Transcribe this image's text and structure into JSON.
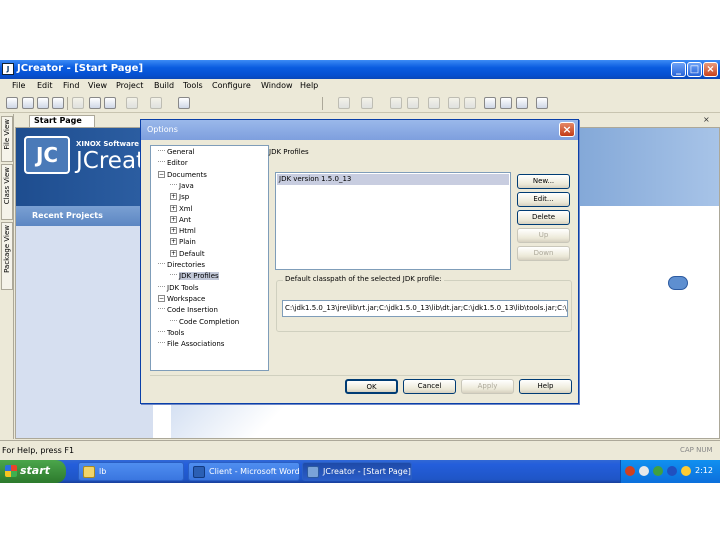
{
  "window": {
    "title": "JCreator - [Start Page]",
    "icon": "app-icon"
  },
  "menu": [
    "File",
    "Edit",
    "Find",
    "View",
    "Project",
    "Build",
    "Tools",
    "Configure",
    "Window",
    "Help"
  ],
  "side_tabs": [
    "File View",
    "Class View",
    "Package View"
  ],
  "doc_tab": {
    "label": "Start Page"
  },
  "start_page": {
    "vendor": "XINOX Software",
    "product": "JCreator",
    "recent_projects": "Recent Projects"
  },
  "status": {
    "text": "For Help, press F1",
    "keys": "CAP NUM"
  },
  "taskbar": {
    "start": "start",
    "tasks": [
      "lb",
      "Client - Microsoft Word",
      "JCreator - [Start Page]"
    ],
    "clock": "2:12"
  },
  "dialog": {
    "title": "Options",
    "tree": [
      {
        "label": "General",
        "level": 0,
        "expander": "none"
      },
      {
        "label": "Editor",
        "level": 0,
        "expander": "none"
      },
      {
        "label": "Documents",
        "level": 0,
        "expander": "minus"
      },
      {
        "label": "Java",
        "level": 1,
        "expander": "none"
      },
      {
        "label": "Jsp",
        "level": 1,
        "expander": "plus"
      },
      {
        "label": "Xml",
        "level": 1,
        "expander": "plus"
      },
      {
        "label": "Ant",
        "level": 1,
        "expander": "plus"
      },
      {
        "label": "Html",
        "level": 1,
        "expander": "plus"
      },
      {
        "label": "Plain",
        "level": 1,
        "expander": "plus"
      },
      {
        "label": "Default",
        "level": 1,
        "expander": "plus"
      },
      {
        "label": "Directories",
        "level": 0,
        "expander": "none"
      },
      {
        "label": "JDK Profiles",
        "level": 1,
        "expander": "none",
        "selected": true
      },
      {
        "label": "JDK Tools",
        "level": 0,
        "expander": "none"
      },
      {
        "label": "Workspace",
        "level": 0,
        "expander": "minus"
      },
      {
        "label": "Code Insertion",
        "level": 0,
        "expander": "none"
      },
      {
        "label": "Code Completion",
        "level": 1,
        "expander": "none"
      },
      {
        "label": "Tools",
        "level": 0,
        "expander": "none"
      },
      {
        "label": "File Associations",
        "level": 0,
        "expander": "none"
      }
    ],
    "jdk_profiles_label": "JDK Profiles",
    "jdk_list": [
      "JDK version 1.5.0_13"
    ],
    "buttons": {
      "new": "New...",
      "edit": "Edit...",
      "delete": "Delete",
      "up": "Up",
      "down": "Down"
    },
    "classpath_label": "Default classpath of the selected JDK profile:",
    "classpath_value": "C:\\jdk1.5.0_13\\jre\\lib\\rt.jar;C:\\jdk1.5.0_13\\lib\\dt.jar;C:\\jdk1.5.0_13\\lib\\tools.jar;C:\\j",
    "footer": {
      "ok": "OK",
      "cancel": "Cancel",
      "apply": "Apply",
      "help": "Help"
    }
  }
}
